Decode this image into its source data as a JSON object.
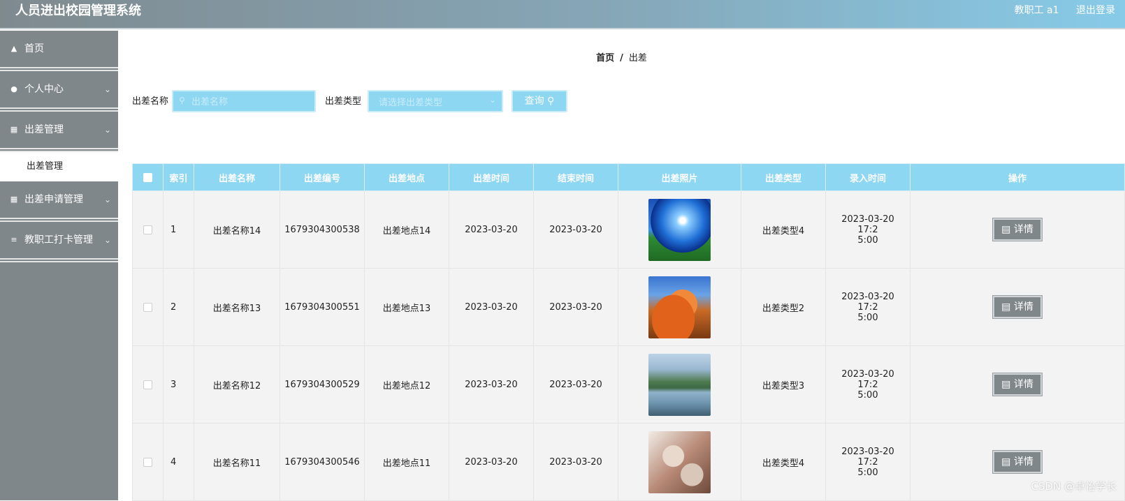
{
  "app": {
    "title": "人员进出校园管理系统",
    "user_label": "教职工 a1",
    "logout_label": "退出登录"
  },
  "sidebar": {
    "items": [
      {
        "label": "首页",
        "icon": "home-icon"
      },
      {
        "label": "个人中心",
        "icon": "user-icon"
      },
      {
        "label": "出差管理",
        "icon": "grid-icon"
      },
      {
        "label": "出差申请管理",
        "icon": "grid-icon"
      },
      {
        "label": "教职工打卡管理",
        "icon": "list-icon"
      }
    ],
    "submenu_label": "出差管理"
  },
  "breadcrumb": {
    "home": "首页",
    "separator": "/",
    "current": "出差"
  },
  "search": {
    "name_label": "出差名称",
    "name_placeholder": "出差名称",
    "type_label": "出差类型",
    "type_placeholder": "请选择出差类型",
    "query_button": "查询"
  },
  "table": {
    "headers": [
      "索引",
      "出差名称",
      "出差编号",
      "出差地点",
      "出差时间",
      "结束时间",
      "出差照片",
      "出差类型",
      "录入时间",
      "操作"
    ],
    "detail_label": "详情",
    "rows": [
      {
        "index": "1",
        "name": "出差名称14",
        "code": "1679304300538",
        "place": "出差地点14",
        "start": "2023-03-20",
        "end": "2023-03-20",
        "type": "出差类型4",
        "entry_time_l1": "2023-03-20 17:2",
        "entry_time_l2": "5:00"
      },
      {
        "index": "2",
        "name": "出差名称13",
        "code": "1679304300551",
        "place": "出差地点13",
        "start": "2023-03-20",
        "end": "2023-03-20",
        "type": "出差类型2",
        "entry_time_l1": "2023-03-20 17:2",
        "entry_time_l2": "5:00"
      },
      {
        "index": "3",
        "name": "出差名称12",
        "code": "1679304300529",
        "place": "出差地点12",
        "start": "2023-03-20",
        "end": "2023-03-20",
        "type": "出差类型3",
        "entry_time_l1": "2023-03-20 17:2",
        "entry_time_l2": "5:00"
      },
      {
        "index": "4",
        "name": "出差名称11",
        "code": "1679304300546",
        "place": "出差地点11",
        "start": "2023-03-20",
        "end": "2023-03-20",
        "type": "出差类型4",
        "entry_time_l1": "2023-03-20 17:2",
        "entry_time_l2": "5:00"
      }
    ]
  },
  "watermark": "CSDN @卓怡学长",
  "colors": {
    "accent": "#8dd7f2",
    "sidebar": "#7f878b",
    "row_bg": "#f3f3f3"
  }
}
